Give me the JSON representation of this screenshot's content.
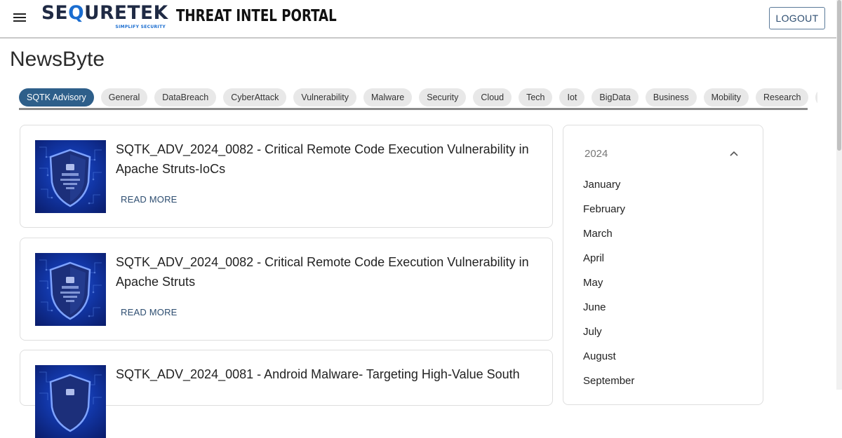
{
  "header": {
    "logo_text_left": "SE",
    "logo_text_q": "Q",
    "logo_text_right": "URETEK",
    "logo_tagline": "SIMPLIFY SECURITY",
    "portal_title": "THREAT INTEL PORTAL",
    "logout_label": "LOGOUT",
    "menu_icon": "hamburger-icon"
  },
  "page": {
    "title": "NewsByte"
  },
  "tabs": [
    {
      "label": "SQTK Advisory",
      "active": true
    },
    {
      "label": "General"
    },
    {
      "label": "DataBreach"
    },
    {
      "label": "CyberAttack"
    },
    {
      "label": "Vulnerability"
    },
    {
      "label": "Malware"
    },
    {
      "label": "Security"
    },
    {
      "label": "Cloud"
    },
    {
      "label": "Tech"
    },
    {
      "label": "Iot"
    },
    {
      "label": "BigData"
    },
    {
      "label": "Business"
    },
    {
      "label": "Mobility"
    },
    {
      "label": "Research"
    },
    {
      "label": "Corporate"
    },
    {
      "label": ""
    }
  ],
  "articles": [
    {
      "title": "SQTK_ADV_2024_0082 - Critical Remote Code Execution Vulnerability in Apache Struts-IoCs",
      "read_more": "READ MORE"
    },
    {
      "title": "SQTK_ADV_2024_0082 - Critical Remote Code Execution Vulnerability in Apache Struts",
      "read_more": "READ MORE"
    },
    {
      "title": "SQTK_ADV_2024_0081 - Android Malware- Targeting High-Value South",
      "read_more": "READ MORE"
    }
  ],
  "archive": {
    "year": "2024",
    "toggle_icon": "chevron-up-icon",
    "months": [
      "January",
      "February",
      "March",
      "April",
      "May",
      "June",
      "July",
      "August",
      "September"
    ]
  },
  "colors": {
    "accent": "#2e5f8a",
    "brand_navy": "#1f2a44",
    "brand_blue": "#1a6dd0",
    "link": "#2d4d70"
  }
}
